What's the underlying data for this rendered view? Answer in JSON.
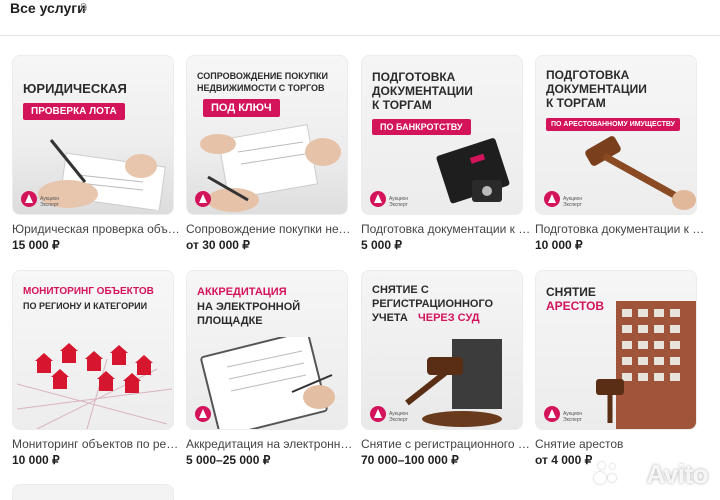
{
  "header": {
    "title": "Все услуги",
    "count": "9"
  },
  "cards": [
    {
      "name": "Юридическая проверка объекта",
      "price": "15 000 ₽",
      "image_text": [
        "ЮРИДИЧЕСКАЯ"
      ],
      "image_pill": "ПРОВЕРКА ЛОТА"
    },
    {
      "name": "Сопровождение покупки недвижимости",
      "price": "от 30 000 ₽",
      "image_text": [
        "СОПРОВОЖДЕНИЕ ПОКУПКИ",
        "НЕДВИЖИМОСТИ С ТОРГОВ"
      ],
      "image_pill": "ПОД КЛЮЧ"
    },
    {
      "name": "Подготовка документации к торгам",
      "price": "5 000 ₽",
      "image_text": [
        "ПОДГОТОВКА",
        "ДОКУМЕНТАЦИИ",
        "К ТОРГАМ"
      ],
      "image_pill": "ПО БАНКРОТСТВУ"
    },
    {
      "name": "Подготовка документации к торгам",
      "price": "10 000 ₽",
      "image_text": [
        "ПОДГОТОВКА",
        "ДОКУМЕНТАЦИИ",
        "К ТОРГАМ"
      ],
      "image_pill": "ПО АРЕСТОВАННОМУ ИМУЩЕСТВУ"
    },
    {
      "name": "Мониторинг объектов по региону",
      "price": "10 000 ₽",
      "image_text": [
        "МОНИТОРИНГ ОБЪЕКТОВ",
        "ПО РЕГИОНУ И КАТЕГОРИИ"
      ],
      "image_pill": ""
    },
    {
      "name": "Аккредитация на электронной площадке",
      "price": "5 000–25 000 ₽",
      "image_text": [
        "АККРЕДИТАЦИЯ",
        "НА ЭЛЕКТРОННОЙ",
        "ПЛОЩАДКЕ"
      ],
      "image_pill": ""
    },
    {
      "name": "Снятие с регистрационного учета",
      "price": "70 000–100 000 ₽",
      "image_text": [
        "СНЯТИЕ С",
        "РЕГИСТРАЦИОННОГО",
        "УЧЕТА",
        "ЧЕРЕЗ СУД"
      ],
      "image_pill": ""
    },
    {
      "name": "Снятие арестов",
      "price": "от 4 000 ₽",
      "image_text": [
        "СНЯТИЕ",
        "АРЕСТОВ"
      ],
      "image_pill": ""
    }
  ],
  "brand": {
    "logo_line1": "Аукцион",
    "logo_line2": "Эксперт",
    "accent": "#d4145a"
  },
  "watermark": "Avito"
}
